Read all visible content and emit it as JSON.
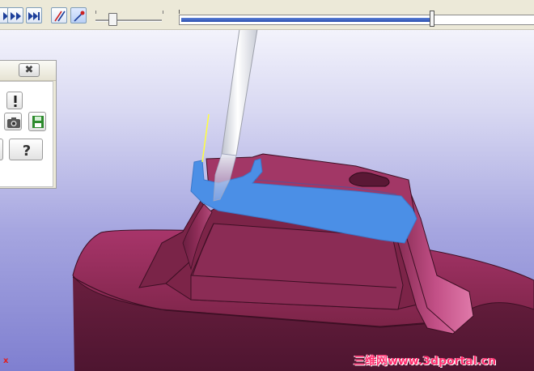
{
  "toolbar": {
    "icons": [
      "step-forward-icon",
      "fast-forward-icon",
      "skip-to-end-icon",
      "tool-path-icon",
      "tool-probe-icon"
    ],
    "speed_slider_value": 0.25,
    "progress_value": 0.72
  },
  "panel": {
    "close_label": "✖",
    "icons": [
      "exclamation-icon",
      "camera-icon",
      "save-disk-icon",
      "question-mark-icon"
    ]
  },
  "viewport": {
    "axis_label": "x",
    "watermark": "三维网www.3dportal.cn",
    "colors": {
      "part": "#8a2a52",
      "part_dark": "#5e1a38",
      "part_highlight": "#d75a94",
      "stock_section": "#4b8fe6",
      "tool": "#f2f2f6",
      "toolpath": "#ffff40"
    }
  }
}
